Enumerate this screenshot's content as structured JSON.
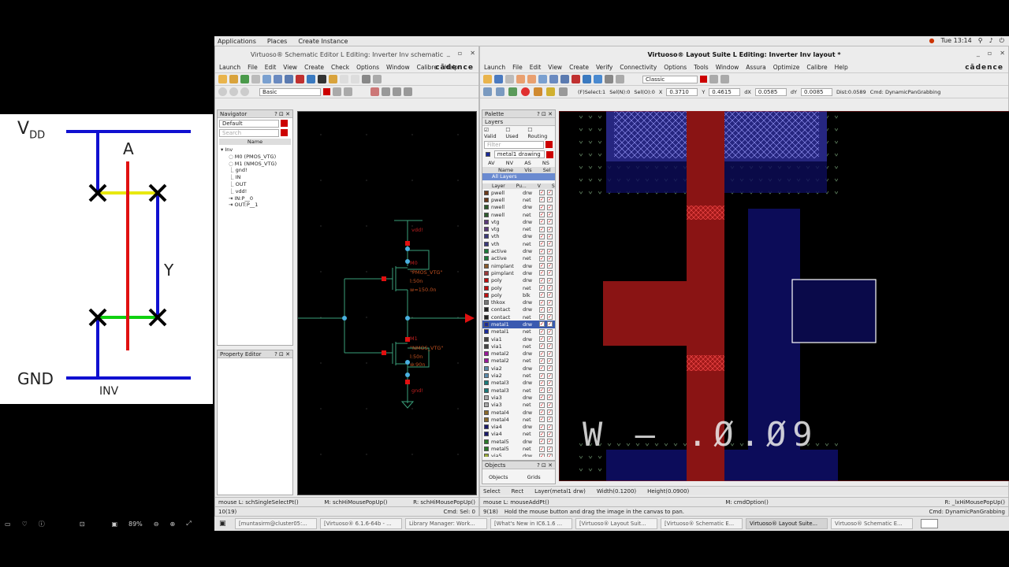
{
  "slide": {
    "vdd": "V",
    "vdd_sub": "DD",
    "gnd": "GND",
    "label_a": "A",
    "label_y": "Y",
    "label_inv": "INV"
  },
  "viewer": {
    "zoom": "89%"
  },
  "topbar": {
    "applications": "Applications",
    "places": "Places",
    "create_instance": "Create Instance",
    "time": "Tue 13:14"
  },
  "schematic": {
    "title": "Virtuoso® Schematic Editor L Editing: Inverter Inv schematic",
    "menus": [
      "Launch",
      "File",
      "Edit",
      "View",
      "Create",
      "Check",
      "Options",
      "Window",
      "Calibre",
      "Help"
    ],
    "logo": "cādence",
    "basic": "Basic",
    "navigator": {
      "title": "Navigator",
      "filter": "Default",
      "search_placeholder": "Search",
      "col": "Name",
      "items": [
        "Inv",
        "M0 (PMOS_VTG)",
        "M1 (NMOS_VTG)",
        "gnd!",
        "IN",
        "OUT",
        "vdd!",
        "IN:P__0",
        "OUT:P__1"
      ]
    },
    "property_editor": "Property Editor",
    "labels": {
      "vdd": "vdd!",
      "m0": "M0",
      "pmos": "\"PMOS_VTG\"",
      "pl": "l:50n",
      "pw": "w=150.0n",
      "m1": "M1",
      "nmos": "\"NMOS_VTG\"",
      "nl": "l:50n",
      "nw": "w:90n",
      "gnd": "gnd!"
    },
    "status": {
      "left": "mouse L: schSingleSelectPt()",
      "mid": "M: schHiMousePopUp()",
      "right": "R: schHiMousePopUp()",
      "cmd_left": "10(19)",
      "cmd_right": "Cmd: Sel: 0"
    }
  },
  "layout": {
    "title": "Virtuoso® Layout Suite L Editing: Inverter Inv layout *",
    "menus": [
      "Launch",
      "File",
      "Edit",
      "View",
      "Create",
      "Verify",
      "Connectivity",
      "Options",
      "Tools",
      "Window",
      "Assura",
      "Optimize",
      "Calibre",
      "Help"
    ],
    "logo": "cādence",
    "classic": "Classic",
    "coords": {
      "select": "(F)Select:1",
      "seln": "Sel(N):0",
      "selo": "Sel(O):0",
      "x": "0.3710",
      "y": "0.4615",
      "dx": "0.0585",
      "dy": "0.0085",
      "dist": "Dist:0.0589",
      "cmd": "Cmd: DynamicPanGrabbing"
    },
    "palette": {
      "title": "Palette",
      "layers": "Layers",
      "valid": "Valid",
      "used": "Used",
      "routing": "Routing",
      "filter": "Filter",
      "current": "metal1 drawing",
      "tabs": [
        "AV",
        "NV",
        "AS",
        "NS"
      ],
      "name": "Name",
      "vis": "Vis",
      "sel": "Sel",
      "all_layers": "All Layers",
      "cols": [
        "Layer",
        "Pu...",
        "V",
        "S"
      ],
      "rows": [
        [
          "pwell",
          "drw",
          "#6b3a1a"
        ],
        [
          "pwell",
          "net",
          "#6b3a1a"
        ],
        [
          "nwell",
          "drw",
          "#2c5a2c"
        ],
        [
          "nwell",
          "net",
          "#2c5a2c"
        ],
        [
          "vtg",
          "drw",
          "#5a3a7a"
        ],
        [
          "vtg",
          "net",
          "#5a3a7a"
        ],
        [
          "vth",
          "drw",
          "#3a3a7a"
        ],
        [
          "vth",
          "net",
          "#3a3a7a"
        ],
        [
          "active",
          "drw",
          "#1d7a3a"
        ],
        [
          "active",
          "net",
          "#1d7a3a"
        ],
        [
          "nimplant",
          "drw",
          "#8a5a2a"
        ],
        [
          "pimplant",
          "drw",
          "#9a3a3a"
        ],
        [
          "poly",
          "drw",
          "#c01010"
        ],
        [
          "poly",
          "net",
          "#c01010"
        ],
        [
          "poly",
          "blk",
          "#c01010"
        ],
        [
          "thkox",
          "drw",
          "#777777"
        ],
        [
          "contact",
          "drw",
          "#222222"
        ],
        [
          "contact",
          "net",
          "#222222"
        ],
        [
          "metal1",
          "drw",
          "#1a2a9a"
        ],
        [
          "metal1",
          "net",
          "#1a2a9a"
        ],
        [
          "via1",
          "drw",
          "#444444"
        ],
        [
          "via1",
          "net",
          "#444444"
        ],
        [
          "metal2",
          "drw",
          "#9a1a9a"
        ],
        [
          "metal2",
          "net",
          "#9a1a9a"
        ],
        [
          "via2",
          "drw",
          "#5a8aaa"
        ],
        [
          "via2",
          "net",
          "#5a8aaa"
        ],
        [
          "metal3",
          "drw",
          "#1a7a7a"
        ],
        [
          "metal3",
          "net",
          "#1a7a7a"
        ],
        [
          "via3",
          "drw",
          "#aaaaaa"
        ],
        [
          "via3",
          "net",
          "#aaaaaa"
        ],
        [
          "metal4",
          "drw",
          "#8a6a2a"
        ],
        [
          "metal4",
          "net",
          "#8a6a2a"
        ],
        [
          "via4",
          "drw",
          "#1a1a6a"
        ],
        [
          "via4",
          "net",
          "#1a1a6a"
        ],
        [
          "metal5",
          "drw",
          "#2a7a2a"
        ],
        [
          "metal5",
          "net",
          "#2a7a2a"
        ],
        [
          "via5",
          "drw",
          "#9aaa3a"
        ]
      ],
      "objects": "Objects",
      "objects_tab": "Objects",
      "grids_tab": "Grids"
    },
    "canvas_text": "W — .Ø.Ø9",
    "status": {
      "select": "Select",
      "rect": "Rect",
      "layer": "Layer(metal1 drw)",
      "width": "Width(0.1200)",
      "height": "Height(0.0900)",
      "mouse_l": "mouse L: mouseAddPt()",
      "mouse_m": "M: cmdOption()",
      "mouse_r": "R: _lxHiMousePopUp()",
      "cmd_left": "9(18)",
      "hint": "Hold the mouse button and drag the image in the canvas to pan.",
      "cmd_right": "Cmd: DynamicPanGrabbing"
    }
  },
  "taskbar": [
    {
      "label": "[muntasirm@cluster05:...",
      "active": false
    },
    {
      "label": "[Virtuoso® 6.1.6-64b - ...",
      "active": false
    },
    {
      "label": "Library Manager: Work...",
      "active": false
    },
    {
      "label": "[What's New in IC6.1.6 ...",
      "active": false
    },
    {
      "label": "[Virtuoso® Layout Suit...",
      "active": false
    },
    {
      "label": "[Virtuoso® Schematic E...",
      "active": false
    },
    {
      "label": "Virtuoso® Layout Suite...",
      "active": true
    },
    {
      "label": "Virtuoso® Schematic E...",
      "active": false
    }
  ]
}
